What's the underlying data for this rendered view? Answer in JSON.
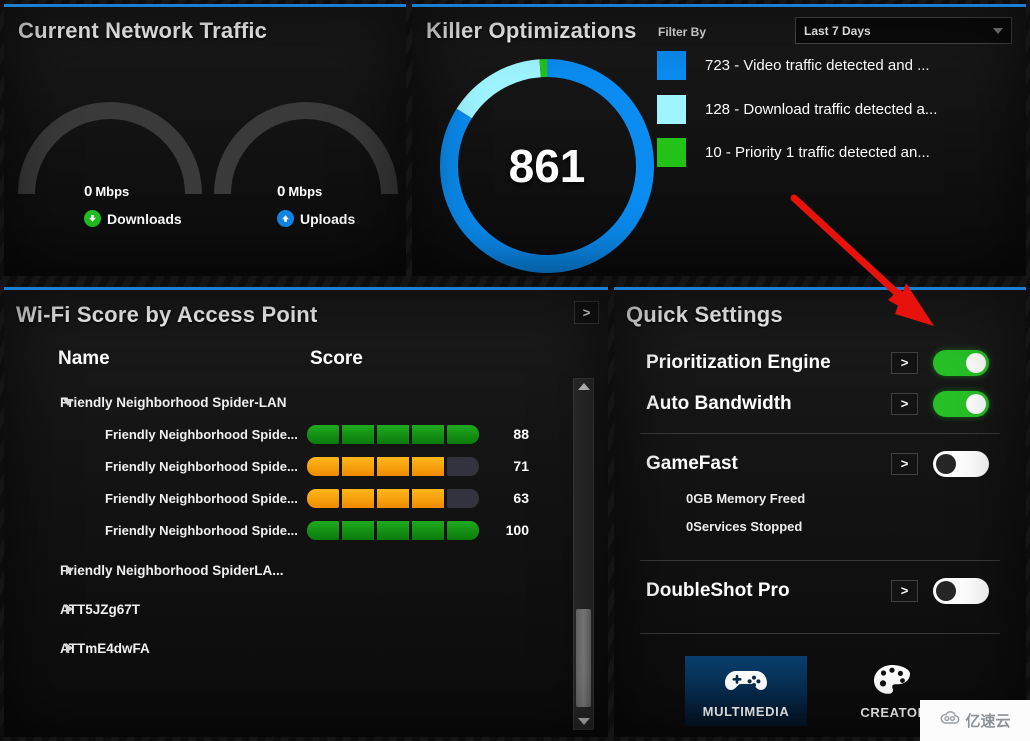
{
  "traffic": {
    "title": "Current Network Traffic",
    "gauges": [
      {
        "value": "0",
        "unit": "Mbps",
        "label": "Downloads",
        "icon": "arrow-down-circle-icon",
        "icon_glyph": "▼",
        "color": "#20c020"
      },
      {
        "value": "0",
        "unit": "Mbps",
        "label": "Uploads",
        "icon": "arrow-up-circle-icon",
        "icon_glyph": "▲",
        "color": "#1287e8"
      }
    ]
  },
  "killer": {
    "title": "Killer Optimizations",
    "filter_label": "Filter By",
    "filter_value": "Last 7 Days",
    "total": "861",
    "legend": [
      {
        "color": "#0a8cf0",
        "count": "723",
        "text": "723 -  Video traffic detected and ..."
      },
      {
        "color": "#9ef5ff",
        "count": "128",
        "text": "128 -  Download traffic detected a..."
      },
      {
        "color": "#22c316",
        "count": "10",
        "text": "10 -  Priority 1 traffic detected an..."
      }
    ]
  },
  "chart_data": {
    "type": "pie",
    "title": "Killer Optimizations",
    "center_label": "861",
    "labels": [
      "Video traffic detected and ...",
      "Download traffic detected a...",
      "Priority 1 traffic detected an..."
    ],
    "values": [
      723,
      128,
      10
    ],
    "colors": [
      "#0a8cf0",
      "#9ef5ff",
      "#22c316"
    ],
    "total": 861,
    "legend_position": "right",
    "filter": "Last 7 Days"
  },
  "wifi": {
    "title": "Wi-Fi Score by Access Point",
    "expand_icon": "chevron-right-icon",
    "expand_label": ">",
    "columns": {
      "name": "Name",
      "score": "Score"
    },
    "rows": [
      {
        "type": "group",
        "expanded": true,
        "label": "Friendly Neighborhood Spider-LAN"
      },
      {
        "type": "child",
        "label": "Friendly Neighborhood Spide...",
        "score": "88",
        "filled": 5,
        "color": "green"
      },
      {
        "type": "child",
        "label": "Friendly Neighborhood Spide...",
        "score": "71",
        "filled": 4,
        "color": "amber"
      },
      {
        "type": "child",
        "label": "Friendly Neighborhood Spide...",
        "score": "63",
        "filled": 4,
        "color": "amber"
      },
      {
        "type": "child",
        "label": "Friendly Neighborhood Spide...",
        "score": "100",
        "filled": 5,
        "color": "green"
      },
      {
        "type": "group",
        "expanded": false,
        "label": "Friendly Neighborhood SpiderLA..."
      },
      {
        "type": "group",
        "expanded": false,
        "label": "ATT5JZg67T"
      },
      {
        "type": "group",
        "expanded": false,
        "label": "ATTmE4dwFA"
      }
    ]
  },
  "quick": {
    "title": "Quick Settings",
    "arrow_label": ">",
    "settings": [
      {
        "name": "Prioritization Engine",
        "state": "on"
      },
      {
        "name": "Auto Bandwidth",
        "state": "on"
      },
      {
        "name": "GameFast",
        "state": "off",
        "sub": [
          "0GB Memory Freed",
          "0Services Stopped"
        ]
      },
      {
        "name": "DoubleShot Pro",
        "state": "off"
      }
    ],
    "profiles": [
      {
        "name": "MULTIMEDIA",
        "icon": "gamepad-icon",
        "active": true
      },
      {
        "name": "CREATOR",
        "icon": "palette-icon",
        "active": false
      }
    ]
  },
  "watermark": {
    "text": "亿速云",
    "icon": "cloud-icon"
  },
  "annotation": {
    "type": "arrow",
    "color": "#e8120c"
  }
}
